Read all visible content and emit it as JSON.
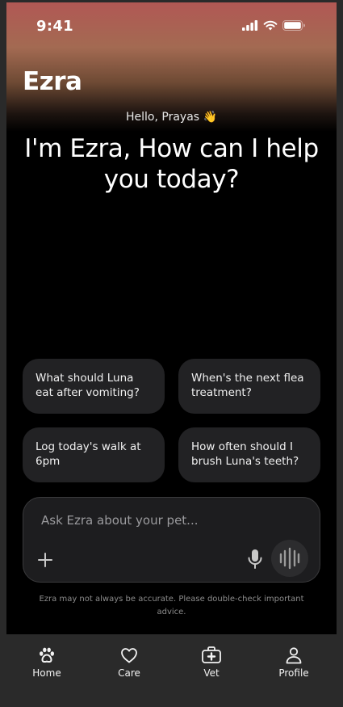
{
  "status_bar": {
    "time": "9:41",
    "icons": [
      "cellular-signal-icon",
      "wifi-icon",
      "battery-icon"
    ]
  },
  "header": {
    "app_title": "Ezra"
  },
  "hero": {
    "greeting": "Hello, Prayas 👋",
    "headline": "I'm Ezra, How can I help you today?"
  },
  "suggestions": [
    {
      "label": "What should Luna eat after vomiting?"
    },
    {
      "label": "When's the next flea treatment?"
    },
    {
      "label": "Log today's walk at 6pm"
    },
    {
      "label": "How often should I brush Luna's teeth?"
    }
  ],
  "composer": {
    "placeholder": "Ask Ezra about your pet...",
    "value": "",
    "icons": [
      "plus-icon",
      "microphone-icon",
      "voice-waveform-icon"
    ]
  },
  "disclaimer": "Ezra may not always be accurate. Please double-check important advice.",
  "tabbar": {
    "items": [
      {
        "label": "Home",
        "icon": "paw-icon",
        "active": true
      },
      {
        "label": "Care",
        "icon": "heart-icon",
        "active": false
      },
      {
        "label": "Vet",
        "icon": "medical-kit-icon",
        "active": false
      },
      {
        "label": "Profile",
        "icon": "user-icon",
        "active": false
      }
    ]
  },
  "colors": {
    "background": "#000000",
    "header_gradient_top": "#b15854",
    "chip_background": "#222224",
    "tabbar_background": "#2a2a2a",
    "text_primary": "#ffffff",
    "text_muted": "#8c8c8c"
  }
}
